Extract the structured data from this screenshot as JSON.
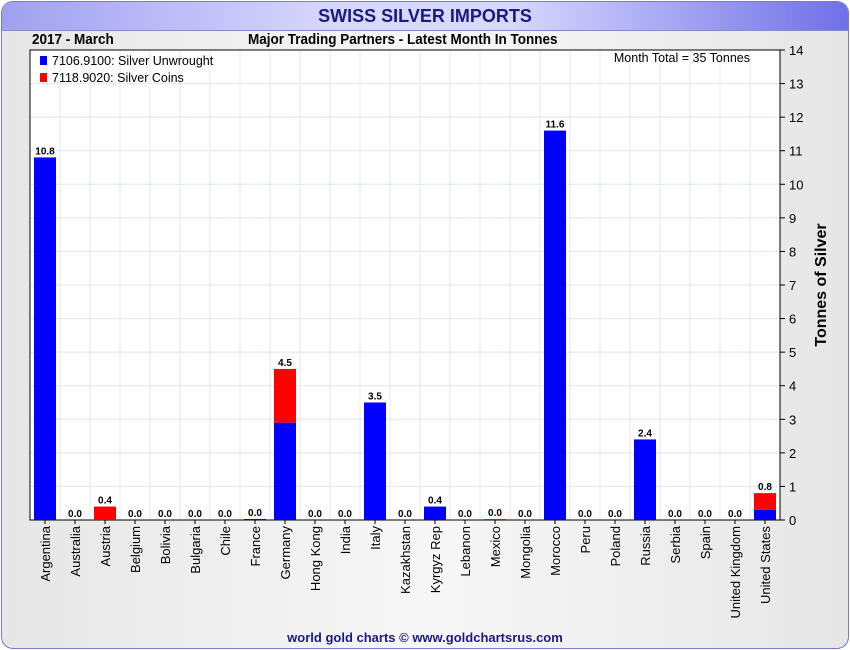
{
  "title": "SWISS SILVER IMPORTS",
  "period": "2017 - March",
  "subtitle": "Major Trading Partners - Latest Month In Tonnes",
  "month_total": "Month Total = 35 Tonnes",
  "footer": "world gold charts © www.goldchartsrus.com",
  "chart_data": {
    "type": "bar",
    "stacked": true,
    "ylabel": "Tonnes of Silver",
    "ylim": [
      0,
      14
    ],
    "yticks": [
      0,
      1,
      2,
      3,
      4,
      5,
      6,
      7,
      8,
      9,
      10,
      11,
      12,
      13,
      14
    ],
    "legend_position": "top-left",
    "grid": true,
    "categories": [
      "Argentina",
      "Australia",
      "Austria",
      "Belgium",
      "Bolivia",
      "Bulgaria",
      "Chile",
      "France",
      "Germany",
      "Hong Kong",
      "India",
      "Italy",
      "Kazakhstan",
      "Kyrgyz Rep",
      "Lebanon",
      "Mexico",
      "Mongolia",
      "Morocco",
      "Peru",
      "Poland",
      "Russia",
      "Serbia",
      "Spain",
      "United Kingdom",
      "United States"
    ],
    "series": [
      {
        "name": "7106.9100: Silver Unwrought",
        "color": "#0000ff",
        "values": [
          10.8,
          0,
          0,
          0,
          0,
          0,
          0,
          0.03,
          2.9,
          0,
          0,
          3.5,
          0,
          0.4,
          0,
          0,
          0,
          11.6,
          0,
          0,
          2.4,
          0,
          0,
          0,
          0.3
        ]
      },
      {
        "name": "7118.9020: Silver Coins",
        "color": "#ff0000",
        "values": [
          0,
          0,
          0.4,
          0,
          0,
          0,
          0,
          0,
          1.6,
          0,
          0,
          0,
          0,
          0,
          0,
          0.03,
          0,
          0,
          0,
          0,
          0,
          0,
          0,
          0,
          0.5
        ]
      }
    ],
    "totals_labels": [
      "10.8",
      "0.0",
      "0.4",
      "0.0",
      "0.0",
      "0.0",
      "0.0",
      "0.0",
      "4.5",
      "0.0",
      "0.0",
      "3.5",
      "0.0",
      "0.4",
      "0.0",
      "0.0",
      "0.0",
      "11.6",
      "0.0",
      "0.0",
      "2.4",
      "0.0",
      "0.0",
      "0.0",
      "0.8"
    ]
  }
}
